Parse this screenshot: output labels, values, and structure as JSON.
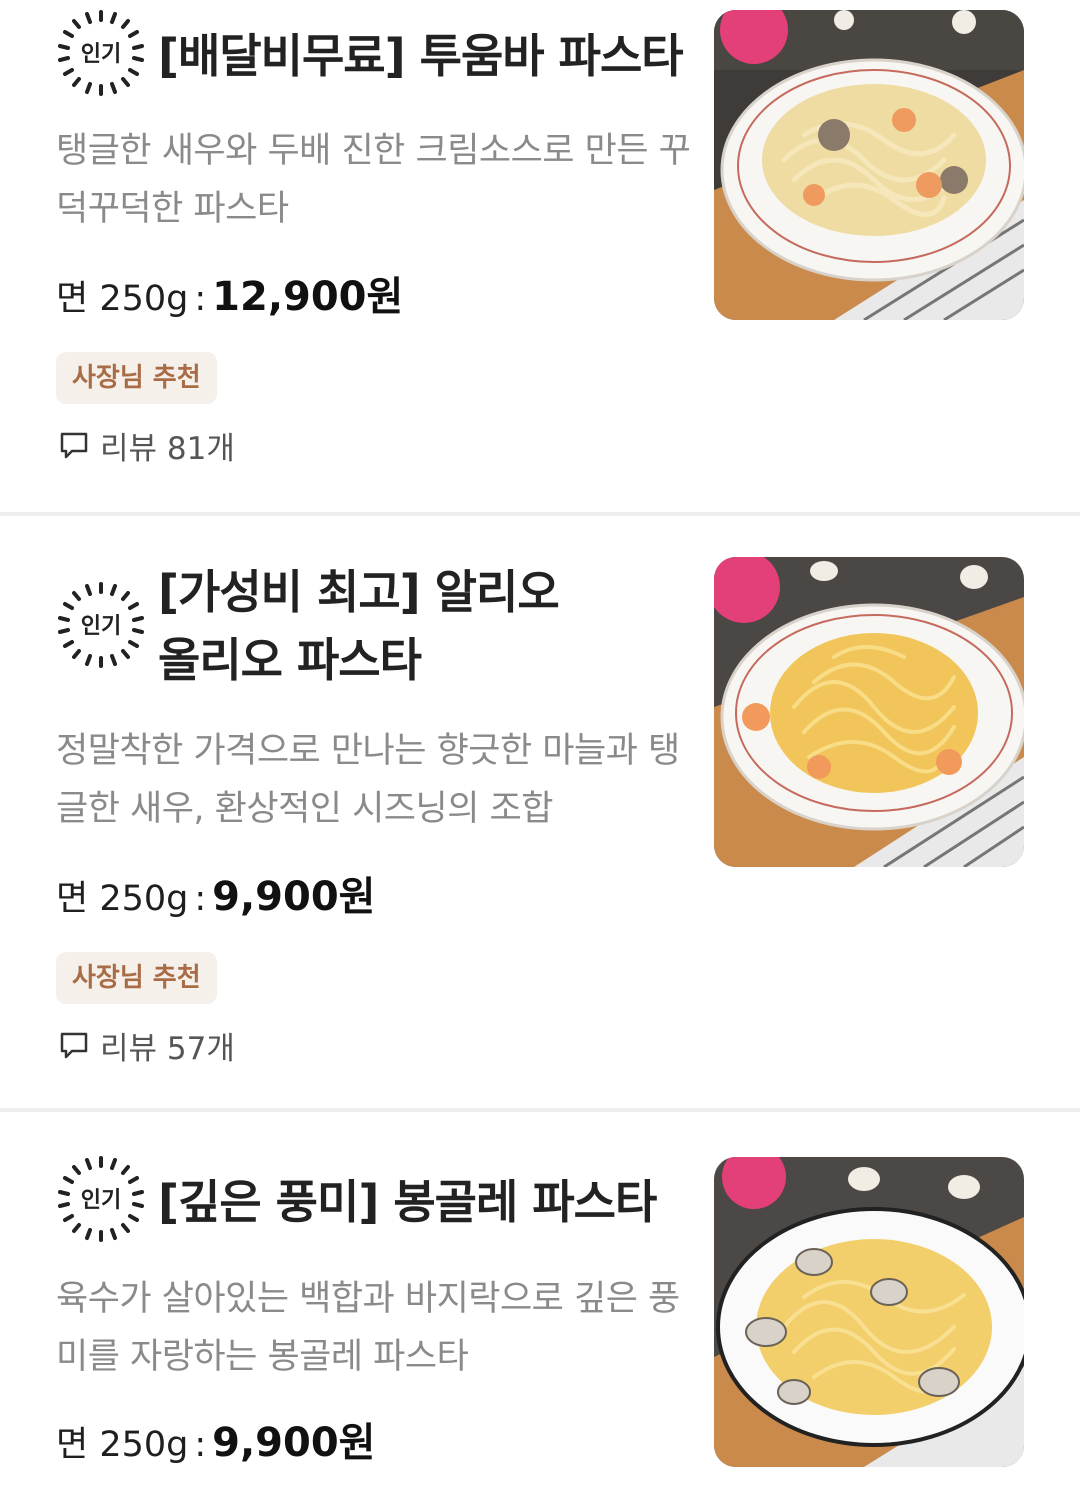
{
  "menu_items": [
    {
      "badge": "인기",
      "title": "[배달비무료] 투움바 파스타",
      "description": "탱글한 새우와 두배 진한 크림소스로 만든 꾸덕꾸덕한 파스타",
      "weight": "면 250g",
      "separator": ":",
      "price": "12,900원",
      "tag": "사장님 추천",
      "review_text": "리뷰 81개",
      "icon": "pasta-photo-cream"
    },
    {
      "badge": "인기",
      "title": "[가성비 최고] 알리오 올리오 파스타",
      "description": "정말착한 가격으로 만나는 향긋한 마늘과 탱글한 새우, 환상적인 시즈닝의 조합",
      "weight": "면 250g",
      "separator": ":",
      "price": "9,900원",
      "tag": "사장님 추천",
      "review_text": "리뷰 57개",
      "icon": "pasta-photo-aglio"
    },
    {
      "badge": "인기",
      "title": "[깊은 풍미] 봉골레 파스타",
      "description": "육수가 살아있는 백합과 바지락으로 깊은 풍미를 자랑하는 봉골레 파스타",
      "weight": "면 250g",
      "separator": ":",
      "price": "9,900원",
      "icon": "pasta-photo-vongole"
    }
  ],
  "colors": {
    "tag_bg": "#f6f0eb",
    "tag_text": "#a86d46",
    "description": "#8a8a8a",
    "divider": "#eeeeee"
  }
}
